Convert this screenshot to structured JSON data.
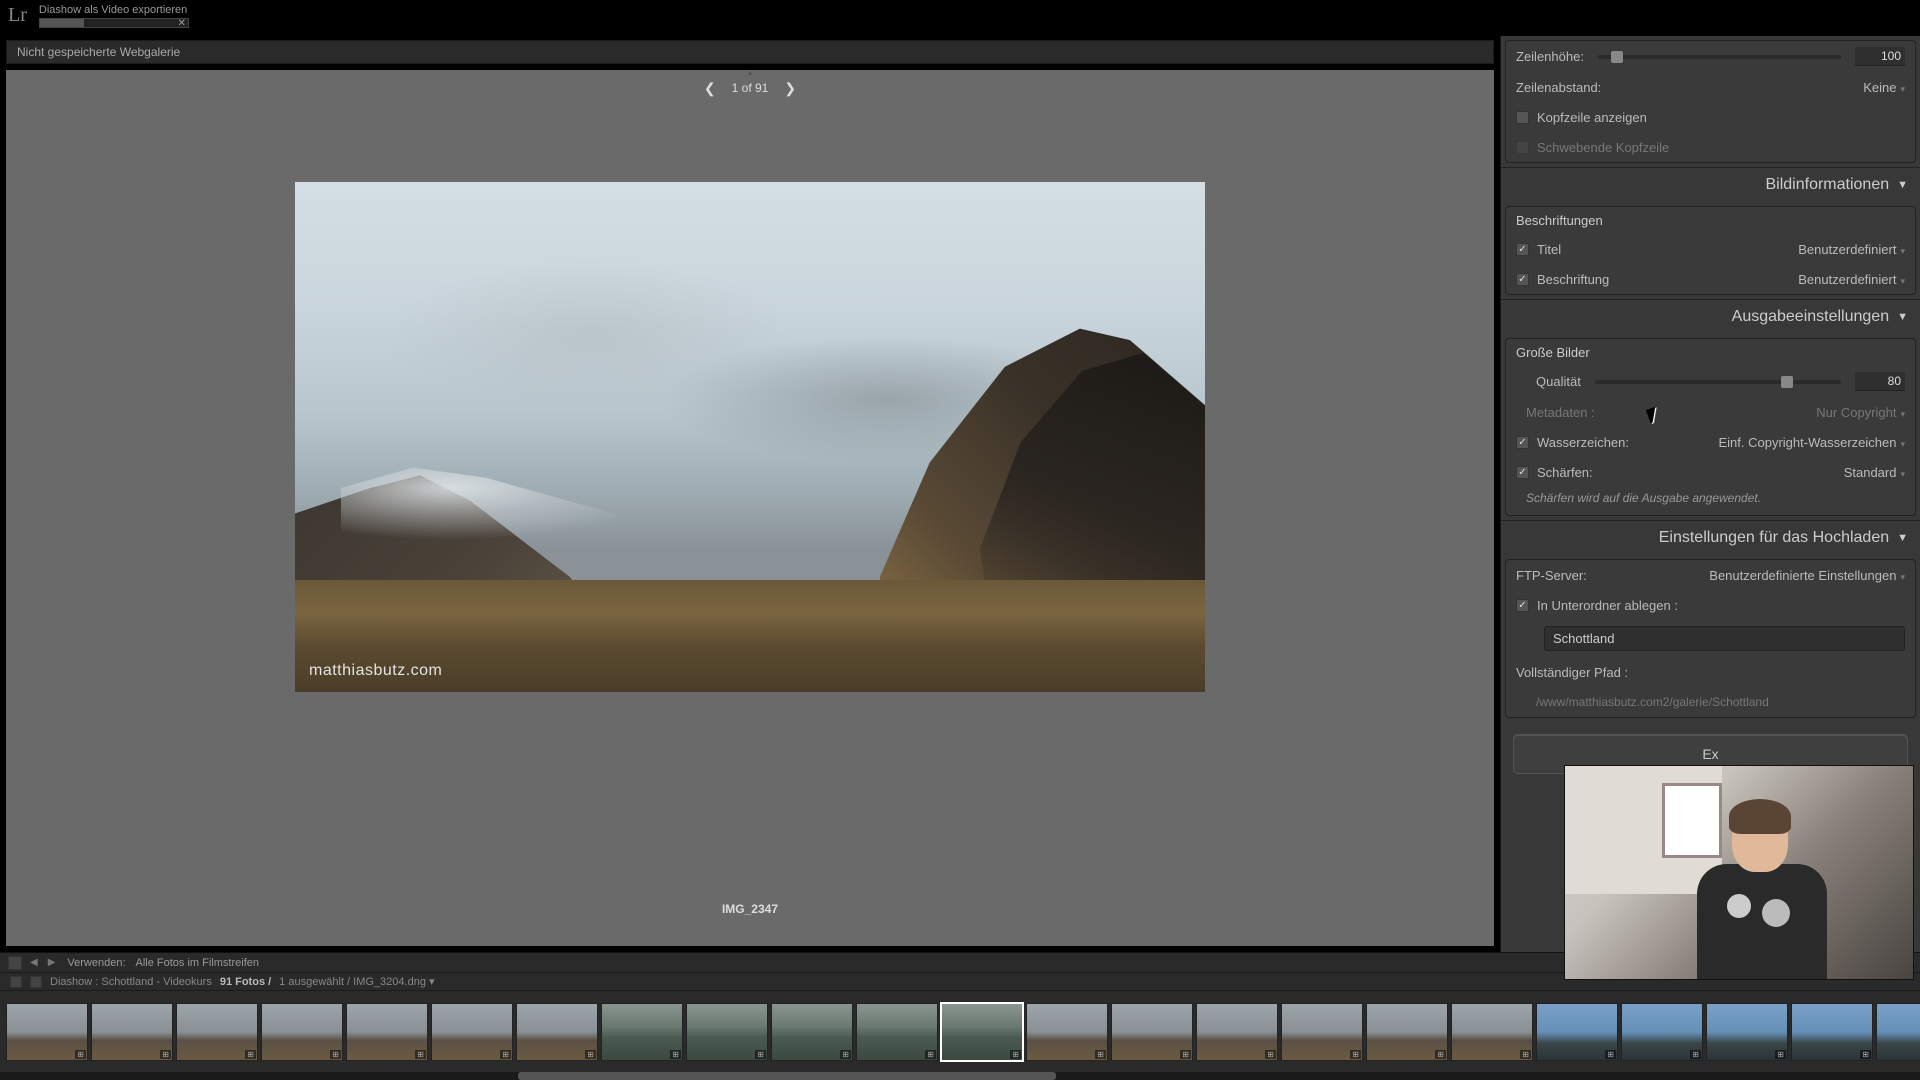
{
  "logo": "Lr",
  "export_status": {
    "title": "Diashow als Video exportieren"
  },
  "gallery_title": "Nicht gespeicherte Webgalerie",
  "pager": {
    "text": "1 of 91"
  },
  "photo": {
    "watermark": "matthiasbutz.com",
    "caption": "IMG_2347"
  },
  "panel": {
    "row_height": {
      "label": "Zeilenhöhe:",
      "value": "100",
      "thumb_pct": 8
    },
    "row_spacing": {
      "label": "Zeilenabstand:",
      "value": "Keine"
    },
    "show_header": {
      "label": "Kopfzeile anzeigen"
    },
    "floating_header": {
      "label": "Schwebende Kopfzeile"
    },
    "section_info": "Bildinformationen",
    "captions_head": "Beschriftungen",
    "title": {
      "label": "Titel",
      "value": "Benutzerdefiniert"
    },
    "caption": {
      "label": "Beschriftung",
      "value": "Benutzerdefiniert"
    },
    "section_output": "Ausgabeeinstellungen",
    "large_images": "Große Bilder",
    "quality": {
      "label": "Qualität",
      "value": "80",
      "thumb_pct": 78
    },
    "metadata": {
      "label": "Metadaten :",
      "value": "Nur Copyright"
    },
    "watermark": {
      "label": "Wasserzeichen:",
      "value": "Einf. Copyright-Wasserzeichen"
    },
    "sharpen": {
      "label": "Schärfen:",
      "value": "Standard"
    },
    "sharpen_note": "Schärfen wird auf die Ausgabe angewendet.",
    "section_upload": "Einstellungen für das Hochladen",
    "ftp": {
      "label": "FTP-Server:",
      "value": "Benutzerdefinierte Einstellungen"
    },
    "subfolder": {
      "label": "In Unterordner ablegen :",
      "value": "Schottland"
    },
    "fullpath": {
      "label": "Vollständiger Pfad :",
      "value": "/www/matthiasbutz.com2/galerie/Schottland"
    },
    "export_btn": "Ex"
  },
  "filmstrip_info": {
    "use_label": "Verwenden:",
    "use_value": "Alle Fotos im Filmstreifen"
  },
  "filmstrip_meta": {
    "path": "Diashow : Schottland - Videokurs",
    "count": "91 Fotos /",
    "selected": "1 ausgewählt / IMG_3204.dng ▾"
  },
  "stars": "★ ★ ★"
}
